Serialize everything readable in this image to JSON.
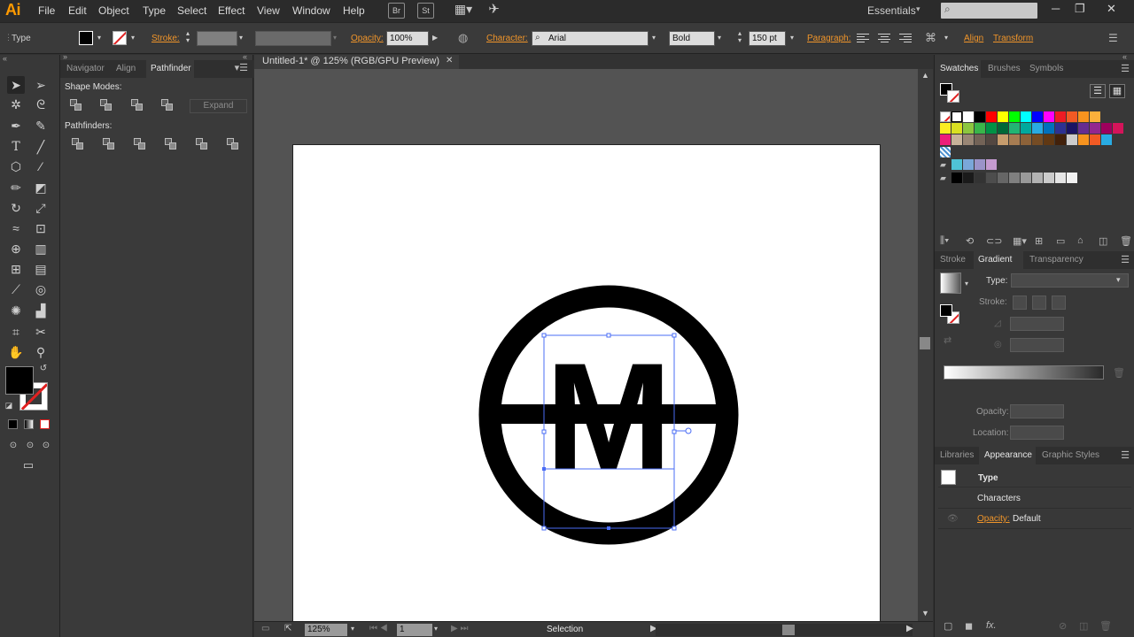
{
  "app": {
    "logo": "Ai",
    "menu": [
      "File",
      "Edit",
      "Object",
      "Type",
      "Select",
      "Effect",
      "View",
      "Window",
      "Help"
    ],
    "bridge_button": "Br",
    "stock_button": "St",
    "workspace": "Essentials",
    "search_placeholder": "",
    "window_buttons": [
      "─",
      "❐",
      "✕"
    ]
  },
  "controlbar": {
    "selection_type": "Type",
    "stroke_label": "Stroke:",
    "opacity_label": "Opacity:",
    "opacity_value": "100%",
    "character_label": "Character:",
    "font_family": "Arial",
    "font_style": "Bold",
    "font_size": "150 pt",
    "paragraph_label": "Paragraph:",
    "align_label": "Align",
    "transform_label": "Transform"
  },
  "left_panel": {
    "tabs": [
      "Navigator",
      "Align",
      "Pathfinder"
    ],
    "active_tab": "Pathfinder",
    "shape_modes_label": "Shape Modes:",
    "expand_label": "Expand",
    "pathfinders_label": "Pathfinders:"
  },
  "document": {
    "tab_title": "Untitled-1* @ 125% (RGB/GPU Preview)",
    "artwork_text": "M"
  },
  "statusbar": {
    "zoom": "125%",
    "artboard_number": "1",
    "current_tool": "Selection"
  },
  "swatches_panel": {
    "tabs": [
      "Swatches",
      "Brushes",
      "Symbols"
    ],
    "colors_row1": [
      "#ffffff",
      "#000000",
      "#ff0000",
      "#ffff00",
      "#00ff00",
      "#00ffff",
      "#0000ff",
      "#ff00ff",
      "#ed1c24",
      "#f15a24",
      "#f7931e",
      "#fbb03b"
    ],
    "colors_row2": [
      "#fcee21",
      "#d9e021",
      "#8cc63f",
      "#39b54a",
      "#009245",
      "#006837",
      "#22b573",
      "#00a99d",
      "#29abe2",
      "#0071bc",
      "#2e3192",
      "#1b1464",
      "#662d91",
      "#93278f",
      "#9e005d",
      "#d4145a"
    ],
    "colors_row3": [
      "#ed1e79",
      "#c7b299",
      "#998675",
      "#736357",
      "#534741",
      "#c69c6d",
      "#a67c52",
      "#8c6239",
      "#754c24",
      "#603813",
      "#42210b",
      "#cccccc",
      "#f7931e",
      "#f15a24",
      "#29abe2"
    ],
    "group_colors": [
      "#4fc3d6",
      "#7aa7d9",
      "#9b93c9",
      "#c59bd0"
    ],
    "grays": [
      "#000000",
      "#1a1a1a",
      "#333333",
      "#4d4d4d",
      "#666666",
      "#808080",
      "#999999",
      "#b3b3b3",
      "#cccccc",
      "#e6e6e6",
      "#f2f2f2"
    ]
  },
  "gradient_panel": {
    "tabs": [
      "Stroke",
      "Gradient",
      "Transparency"
    ],
    "type_label": "Type:",
    "stroke_label": "Stroke:",
    "opacity_label": "Opacity:",
    "location_label": "Location:"
  },
  "appearance_panel": {
    "tabs": [
      "Libraries",
      "Appearance",
      "Graphic Styles"
    ],
    "object_type": "Type",
    "characters_label": "Characters",
    "opacity_label": "Opacity:",
    "opacity_value": "Default"
  }
}
